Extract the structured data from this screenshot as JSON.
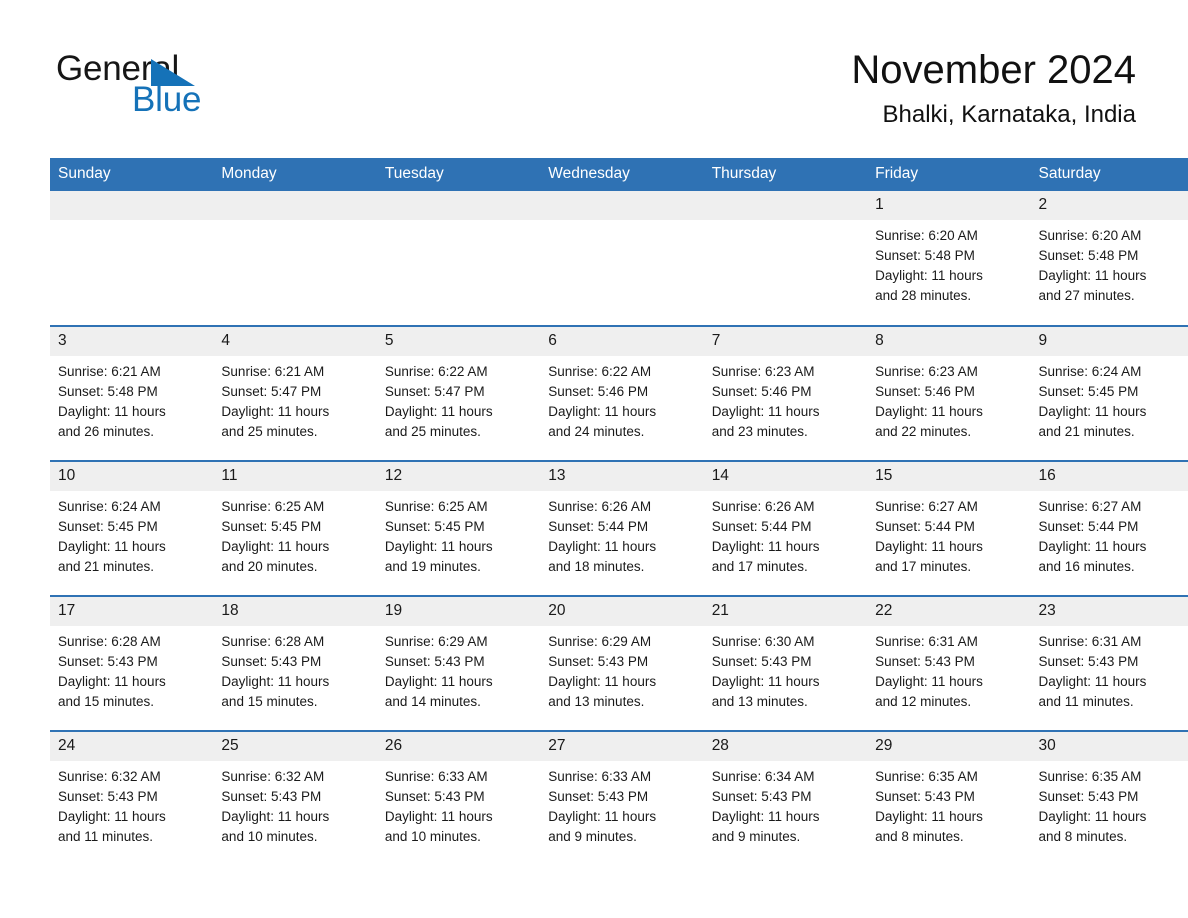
{
  "logo": {
    "line1": "General",
    "line2": "Blue",
    "triangle_color": "#1572b8",
    "icon": "triangle-icon"
  },
  "header": {
    "month_title": "November 2024",
    "location": "Bhalki, Karnataka, India"
  },
  "colors": {
    "header_blue": "#2f72b4",
    "daynum_band": "#efefef",
    "row_separator": "#2f72b4",
    "text": "#1a1a1a"
  },
  "weekdays": [
    "Sunday",
    "Monday",
    "Tuesday",
    "Wednesday",
    "Thursday",
    "Friday",
    "Saturday"
  ],
  "weeks": [
    [
      {
        "day": "",
        "sunrise": "",
        "sunset": "",
        "daylight1": "",
        "daylight2": ""
      },
      {
        "day": "",
        "sunrise": "",
        "sunset": "",
        "daylight1": "",
        "daylight2": ""
      },
      {
        "day": "",
        "sunrise": "",
        "sunset": "",
        "daylight1": "",
        "daylight2": ""
      },
      {
        "day": "",
        "sunrise": "",
        "sunset": "",
        "daylight1": "",
        "daylight2": ""
      },
      {
        "day": "",
        "sunrise": "",
        "sunset": "",
        "daylight1": "",
        "daylight2": ""
      },
      {
        "day": "1",
        "sunrise": "Sunrise: 6:20 AM",
        "sunset": "Sunset: 5:48 PM",
        "daylight1": "Daylight: 11 hours",
        "daylight2": "and 28 minutes."
      },
      {
        "day": "2",
        "sunrise": "Sunrise: 6:20 AM",
        "sunset": "Sunset: 5:48 PM",
        "daylight1": "Daylight: 11 hours",
        "daylight2": "and 27 minutes."
      }
    ],
    [
      {
        "day": "3",
        "sunrise": "Sunrise: 6:21 AM",
        "sunset": "Sunset: 5:48 PM",
        "daylight1": "Daylight: 11 hours",
        "daylight2": "and 26 minutes."
      },
      {
        "day": "4",
        "sunrise": "Sunrise: 6:21 AM",
        "sunset": "Sunset: 5:47 PM",
        "daylight1": "Daylight: 11 hours",
        "daylight2": "and 25 minutes."
      },
      {
        "day": "5",
        "sunrise": "Sunrise: 6:22 AM",
        "sunset": "Sunset: 5:47 PM",
        "daylight1": "Daylight: 11 hours",
        "daylight2": "and 25 minutes."
      },
      {
        "day": "6",
        "sunrise": "Sunrise: 6:22 AM",
        "sunset": "Sunset: 5:46 PM",
        "daylight1": "Daylight: 11 hours",
        "daylight2": "and 24 minutes."
      },
      {
        "day": "7",
        "sunrise": "Sunrise: 6:23 AM",
        "sunset": "Sunset: 5:46 PM",
        "daylight1": "Daylight: 11 hours",
        "daylight2": "and 23 minutes."
      },
      {
        "day": "8",
        "sunrise": "Sunrise: 6:23 AM",
        "sunset": "Sunset: 5:46 PM",
        "daylight1": "Daylight: 11 hours",
        "daylight2": "and 22 minutes."
      },
      {
        "day": "9",
        "sunrise": "Sunrise: 6:24 AM",
        "sunset": "Sunset: 5:45 PM",
        "daylight1": "Daylight: 11 hours",
        "daylight2": "and 21 minutes."
      }
    ],
    [
      {
        "day": "10",
        "sunrise": "Sunrise: 6:24 AM",
        "sunset": "Sunset: 5:45 PM",
        "daylight1": "Daylight: 11 hours",
        "daylight2": "and 21 minutes."
      },
      {
        "day": "11",
        "sunrise": "Sunrise: 6:25 AM",
        "sunset": "Sunset: 5:45 PM",
        "daylight1": "Daylight: 11 hours",
        "daylight2": "and 20 minutes."
      },
      {
        "day": "12",
        "sunrise": "Sunrise: 6:25 AM",
        "sunset": "Sunset: 5:45 PM",
        "daylight1": "Daylight: 11 hours",
        "daylight2": "and 19 minutes."
      },
      {
        "day": "13",
        "sunrise": "Sunrise: 6:26 AM",
        "sunset": "Sunset: 5:44 PM",
        "daylight1": "Daylight: 11 hours",
        "daylight2": "and 18 minutes."
      },
      {
        "day": "14",
        "sunrise": "Sunrise: 6:26 AM",
        "sunset": "Sunset: 5:44 PM",
        "daylight1": "Daylight: 11 hours",
        "daylight2": "and 17 minutes."
      },
      {
        "day": "15",
        "sunrise": "Sunrise: 6:27 AM",
        "sunset": "Sunset: 5:44 PM",
        "daylight1": "Daylight: 11 hours",
        "daylight2": "and 17 minutes."
      },
      {
        "day": "16",
        "sunrise": "Sunrise: 6:27 AM",
        "sunset": "Sunset: 5:44 PM",
        "daylight1": "Daylight: 11 hours",
        "daylight2": "and 16 minutes."
      }
    ],
    [
      {
        "day": "17",
        "sunrise": "Sunrise: 6:28 AM",
        "sunset": "Sunset: 5:43 PM",
        "daylight1": "Daylight: 11 hours",
        "daylight2": "and 15 minutes."
      },
      {
        "day": "18",
        "sunrise": "Sunrise: 6:28 AM",
        "sunset": "Sunset: 5:43 PM",
        "daylight1": "Daylight: 11 hours",
        "daylight2": "and 15 minutes."
      },
      {
        "day": "19",
        "sunrise": "Sunrise: 6:29 AM",
        "sunset": "Sunset: 5:43 PM",
        "daylight1": "Daylight: 11 hours",
        "daylight2": "and 14 minutes."
      },
      {
        "day": "20",
        "sunrise": "Sunrise: 6:29 AM",
        "sunset": "Sunset: 5:43 PM",
        "daylight1": "Daylight: 11 hours",
        "daylight2": "and 13 minutes."
      },
      {
        "day": "21",
        "sunrise": "Sunrise: 6:30 AM",
        "sunset": "Sunset: 5:43 PM",
        "daylight1": "Daylight: 11 hours",
        "daylight2": "and 13 minutes."
      },
      {
        "day": "22",
        "sunrise": "Sunrise: 6:31 AM",
        "sunset": "Sunset: 5:43 PM",
        "daylight1": "Daylight: 11 hours",
        "daylight2": "and 12 minutes."
      },
      {
        "day": "23",
        "sunrise": "Sunrise: 6:31 AM",
        "sunset": "Sunset: 5:43 PM",
        "daylight1": "Daylight: 11 hours",
        "daylight2": "and 11 minutes."
      }
    ],
    [
      {
        "day": "24",
        "sunrise": "Sunrise: 6:32 AM",
        "sunset": "Sunset: 5:43 PM",
        "daylight1": "Daylight: 11 hours",
        "daylight2": "and 11 minutes."
      },
      {
        "day": "25",
        "sunrise": "Sunrise: 6:32 AM",
        "sunset": "Sunset: 5:43 PM",
        "daylight1": "Daylight: 11 hours",
        "daylight2": "and 10 minutes."
      },
      {
        "day": "26",
        "sunrise": "Sunrise: 6:33 AM",
        "sunset": "Sunset: 5:43 PM",
        "daylight1": "Daylight: 11 hours",
        "daylight2": "and 10 minutes."
      },
      {
        "day": "27",
        "sunrise": "Sunrise: 6:33 AM",
        "sunset": "Sunset: 5:43 PM",
        "daylight1": "Daylight: 11 hours",
        "daylight2": "and 9 minutes."
      },
      {
        "day": "28",
        "sunrise": "Sunrise: 6:34 AM",
        "sunset": "Sunset: 5:43 PM",
        "daylight1": "Daylight: 11 hours",
        "daylight2": "and 9 minutes."
      },
      {
        "day": "29",
        "sunrise": "Sunrise: 6:35 AM",
        "sunset": "Sunset: 5:43 PM",
        "daylight1": "Daylight: 11 hours",
        "daylight2": "and 8 minutes."
      },
      {
        "day": "30",
        "sunrise": "Sunrise: 6:35 AM",
        "sunset": "Sunset: 5:43 PM",
        "daylight1": "Daylight: 11 hours",
        "daylight2": "and 8 minutes."
      }
    ]
  ]
}
